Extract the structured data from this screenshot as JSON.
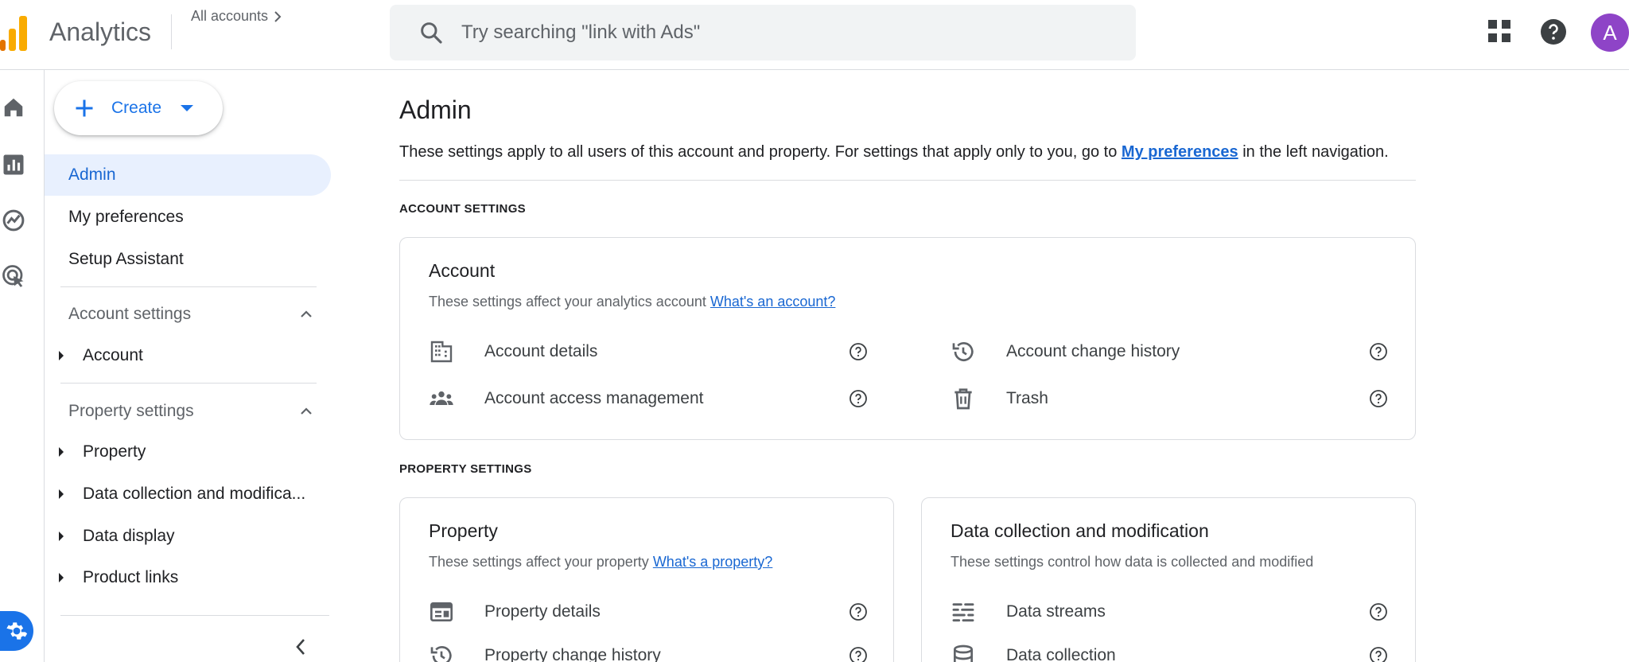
{
  "header": {
    "app_title": "Analytics",
    "breadcrumb": "All accounts",
    "search_placeholder": "Try searching \"link with Ads\"",
    "avatar_letter": "A"
  },
  "icons": {
    "rail": [
      "home-icon",
      "reports-icon",
      "explore-icon",
      "advertising-icon"
    ],
    "admin": "gear-icon"
  },
  "colors": {
    "accent": "#1a73e8",
    "active_bg": "#e8f0fe",
    "avatar": "#8e44c7",
    "logo_orange": "#f9ab00"
  },
  "sidebar": {
    "create_label": "Create",
    "items": [
      {
        "label": "Admin",
        "active": true
      },
      {
        "label": "My preferences"
      },
      {
        "label": "Setup Assistant"
      }
    ],
    "account_settings": {
      "title": "Account settings",
      "children": [
        "Account"
      ]
    },
    "property_settings": {
      "title": "Property settings",
      "children": [
        "Property",
        "Data collection and modifica...",
        "Data display",
        "Product links"
      ]
    }
  },
  "main": {
    "title": "Admin",
    "description_pre": "These settings apply to all users of this account and property. For settings that apply only to you, go to ",
    "description_link": "My preferences",
    "description_post": " in the left navigation.",
    "account_section_label": "ACCOUNT SETTINGS",
    "property_section_label": "PROPERTY SETTINGS",
    "account_card": {
      "title": "Account",
      "subtitle": "These settings affect your analytics account ",
      "subtitle_link": "What's an account?",
      "rows": [
        "Account details",
        "Account change history",
        "Account access management",
        "Trash"
      ]
    },
    "property_card": {
      "title": "Property",
      "subtitle": "These settings affect your property ",
      "subtitle_link": "What's a property?",
      "rows": [
        "Property details",
        "Property change history"
      ]
    },
    "data_card": {
      "title": "Data collection and modification",
      "subtitle": "These settings control how data is collected and modified",
      "rows": [
        "Data streams",
        "Data collection"
      ]
    }
  }
}
